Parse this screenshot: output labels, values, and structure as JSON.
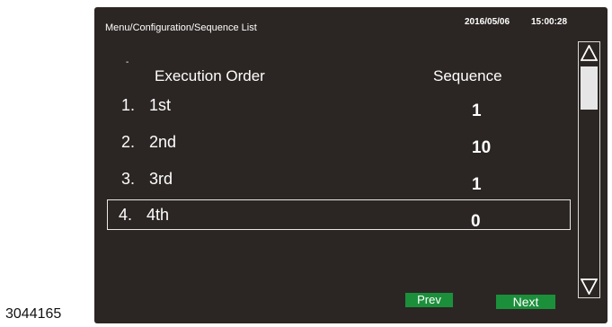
{
  "header": {
    "path": "Menu/Configuration/Sequence List",
    "date": "2016/05/06",
    "time": "15:00:28"
  },
  "columns": {
    "marker": "-",
    "order": "Execution Order",
    "sequence": "Sequence"
  },
  "rows": [
    {
      "num": "1.",
      "order": "1st",
      "sequence": "1",
      "selected": false
    },
    {
      "num": "2.",
      "order": "2nd",
      "sequence": "10",
      "selected": false
    },
    {
      "num": "3.",
      "order": "3rd",
      "sequence": "1",
      "selected": false
    },
    {
      "num": "4.",
      "order": "4th",
      "sequence": "0",
      "selected": true
    }
  ],
  "buttons": {
    "prev": "Prev",
    "next": "Next"
  },
  "scrollbar": {
    "up_icon": "arrow-up-icon",
    "down_icon": "arrow-down-icon"
  },
  "figure_code": "3044165",
  "colors": {
    "screen_background": "#2b2623",
    "button_green": "#1c8f3b",
    "text": "#ffffff"
  }
}
